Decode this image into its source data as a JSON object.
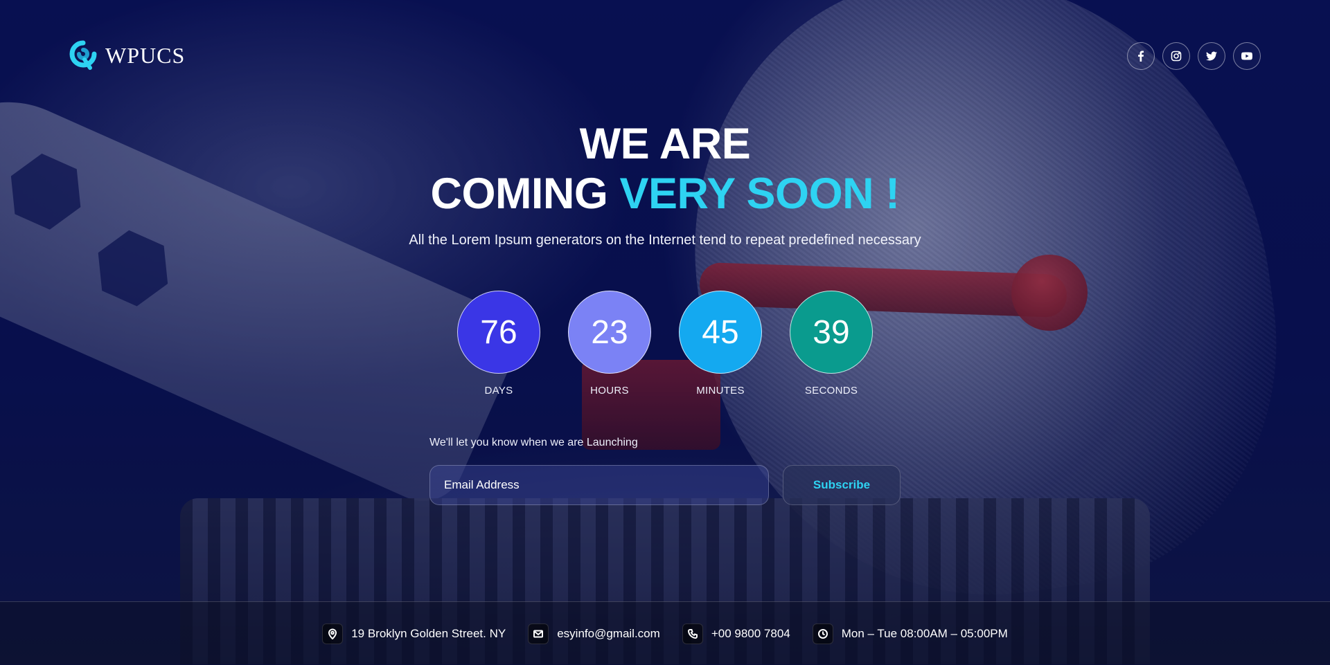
{
  "brand": {
    "name": "WPUCS",
    "logo_icon": "wpucs-logo-icon",
    "accent_color": "#2ed3f2"
  },
  "socials": [
    {
      "name": "facebook",
      "icon": "facebook-icon"
    },
    {
      "name": "instagram",
      "icon": "instagram-icon"
    },
    {
      "name": "twitter",
      "icon": "twitter-icon"
    },
    {
      "name": "youtube",
      "icon": "youtube-icon"
    }
  ],
  "hero": {
    "title_line1": "WE ARE",
    "title_line2_plain": "COMING ",
    "title_line2_accent": "VERY SOON !",
    "subtitle": "All the Lorem Ipsum generators on the Internet tend to repeat predefined necessary"
  },
  "countdown": [
    {
      "value": "76",
      "label": "DAYS",
      "color": "#3a36e6"
    },
    {
      "value": "23",
      "label": "HOURS",
      "color": "#7b82f5"
    },
    {
      "value": "45",
      "label": "MINUTES",
      "color": "#14a9f0"
    },
    {
      "value": "39",
      "label": "SECONDS",
      "color": "#0a9b8e"
    }
  ],
  "subscribe": {
    "prompt": "We'll let you know when we are Launching",
    "email_placeholder": "Email Address",
    "button_label": "Subscribe"
  },
  "footer": {
    "address": "19 Broklyn Golden Street. NY",
    "email": "esyinfo@gmail.com",
    "phone": "+00 9800 7804",
    "hours": "Mon – Tue 08:00AM – 05:00PM"
  }
}
